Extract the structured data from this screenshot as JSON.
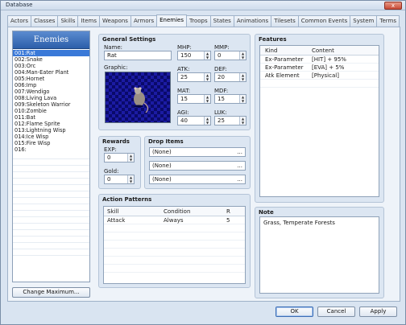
{
  "window": {
    "title": "Database",
    "close_label": "x"
  },
  "tabs": [
    "Actors",
    "Classes",
    "Skills",
    "Items",
    "Weapons",
    "Armors",
    "Enemies",
    "Troops",
    "States",
    "Animations",
    "Tilesets",
    "Common Events",
    "System",
    "Terms"
  ],
  "active_tab": "Enemies",
  "enemy_list": {
    "title": "Enemies",
    "items": [
      "001:Rat",
      "002:Snake",
      "003:Orc",
      "004:Man-Eater Plant",
      "005:Hornet",
      "006:Imp",
      "007:Wendigo",
      "008:Living Lava",
      "009:Skeleton Warrior",
      "010:Zombie",
      "011:Bat",
      "012:Flame Sprite",
      "013:Lightning Wisp",
      "014:Ice Wisp",
      "015:Fire Wisp",
      "016:"
    ],
    "selected_index": 0,
    "change_max_label": "Change Maximum..."
  },
  "general": {
    "title": "General Settings",
    "name_label": "Name:",
    "name_value": "Rat",
    "graphic_label": "Graphic:",
    "mhp_label": "MHP:",
    "mhp": "150",
    "mmp_label": "MMP:",
    "mmp": "0",
    "atk_label": "ATK:",
    "atk": "25",
    "def_label": "DEF:",
    "def": "20",
    "mat_label": "MAT:",
    "mat": "15",
    "mdf_label": "MDF:",
    "mdf": "15",
    "agi_label": "AGI:",
    "agi": "40",
    "luk_label": "LUK:",
    "luk": "25"
  },
  "rewards": {
    "title": "Rewards",
    "exp_label": "EXP:",
    "exp": "0",
    "gold_label": "Gold:",
    "gold": "0"
  },
  "drop_items": {
    "title": "Drop Items",
    "items": [
      "(None)",
      "(None)",
      "(None)"
    ],
    "more_glyph": "..."
  },
  "action_patterns": {
    "title": "Action Patterns",
    "headers": {
      "skill": "Skill",
      "condition": "Condition",
      "r": "R"
    },
    "rows": [
      {
        "skill": "Attack",
        "condition": "Always",
        "r": "5"
      }
    ]
  },
  "features": {
    "title": "Features",
    "headers": {
      "kind": "Kind",
      "content": "Content"
    },
    "rows": [
      {
        "kind": "Ex-Parameter",
        "content": "[HIT] + 95%"
      },
      {
        "kind": "Ex-Parameter",
        "content": "[EVA] + 5%"
      },
      {
        "kind": "Atk Element",
        "content": "[Physical]"
      }
    ]
  },
  "note": {
    "title": "Note",
    "text": "Grass, Temperate Forests"
  },
  "footer": {
    "ok": "OK",
    "cancel": "Cancel",
    "apply": "Apply"
  },
  "colors": {
    "accent": "#3a79d8",
    "list_header": "#2c5faa",
    "panel": "#dce6f2"
  }
}
